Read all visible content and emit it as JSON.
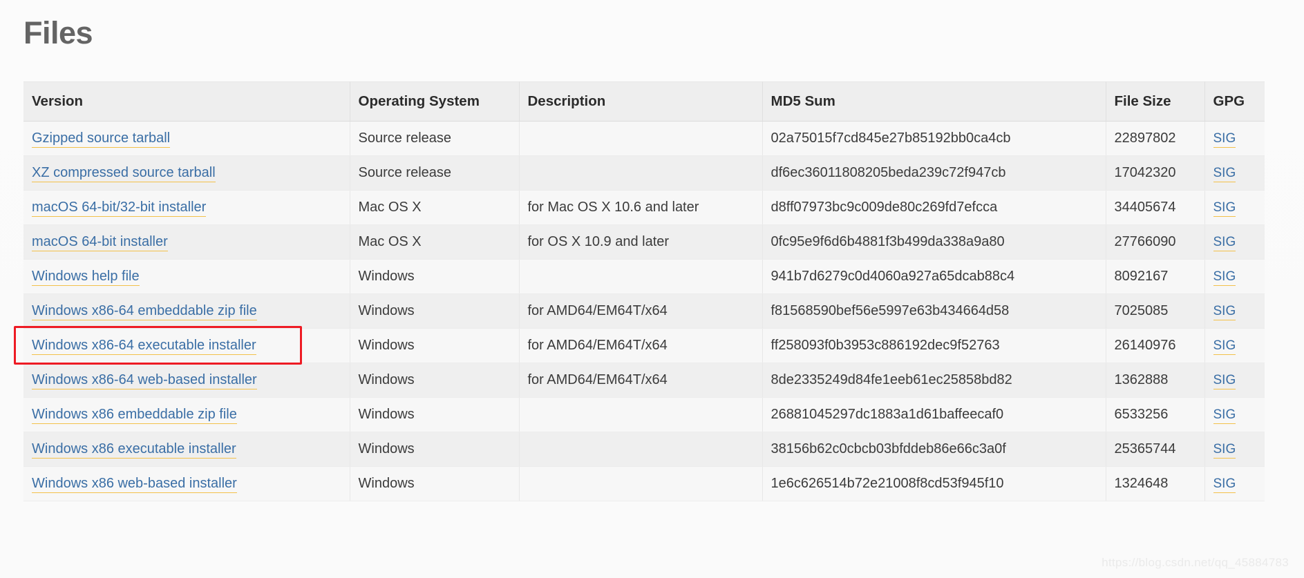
{
  "page": {
    "title": "Files",
    "watermark": "https://blog.csdn.net/qq_45884783"
  },
  "table": {
    "columns": [
      {
        "key": "version",
        "label": "Version"
      },
      {
        "key": "os",
        "label": "Operating System"
      },
      {
        "key": "description",
        "label": "Description"
      },
      {
        "key": "md5",
        "label": "MD5 Sum"
      },
      {
        "key": "filesize",
        "label": "File Size"
      },
      {
        "key": "gpg",
        "label": "GPG"
      }
    ],
    "gpg_link_label": "SIG",
    "rows": [
      {
        "version": "Gzipped source tarball",
        "os": "Source release",
        "description": "",
        "md5": "02a75015f7cd845e27b85192bb0ca4cb",
        "filesize": "22897802",
        "gpg": "SIG"
      },
      {
        "version": "XZ compressed source tarball",
        "os": "Source release",
        "description": "",
        "md5": "df6ec36011808205beda239c72f947cb",
        "filesize": "17042320",
        "gpg": "SIG"
      },
      {
        "version": "macOS 64-bit/32-bit installer",
        "os": "Mac OS X",
        "description": "for Mac OS X 10.6 and later",
        "md5": "d8ff07973bc9c009de80c269fd7efcca",
        "filesize": "34405674",
        "gpg": "SIG"
      },
      {
        "version": "macOS 64-bit installer",
        "os": "Mac OS X",
        "description": "for OS X 10.9 and later",
        "md5": "0fc95e9f6d6b4881f3b499da338a9a80",
        "filesize": "27766090",
        "gpg": "SIG"
      },
      {
        "version": "Windows help file",
        "os": "Windows",
        "description": "",
        "md5": "941b7d6279c0d4060a927a65dcab88c4",
        "filesize": "8092167",
        "gpg": "SIG"
      },
      {
        "version": "Windows x86-64 embeddable zip file",
        "os": "Windows",
        "description": "for AMD64/EM64T/x64",
        "md5": "f81568590bef56e5997e63b434664d58",
        "filesize": "7025085",
        "gpg": "SIG"
      },
      {
        "version": "Windows x86-64 executable installer",
        "os": "Windows",
        "description": "for AMD64/EM64T/x64",
        "md5": "ff258093f0b3953c886192dec9f52763",
        "filesize": "26140976",
        "gpg": "SIG"
      },
      {
        "version": "Windows x86-64 web-based installer",
        "os": "Windows",
        "description": "for AMD64/EM64T/x64",
        "md5": "8de2335249d84fe1eeb61ec25858bd82",
        "filesize": "1362888",
        "gpg": "SIG"
      },
      {
        "version": "Windows x86 embeddable zip file",
        "os": "Windows",
        "description": "",
        "md5": "26881045297dc1883a1d61baffeecaf0",
        "filesize": "6533256",
        "gpg": "SIG"
      },
      {
        "version": "Windows x86 executable installer",
        "os": "Windows",
        "description": "",
        "md5": "38156b62c0cbcb03bfddeb86e66c3a0f",
        "filesize": "25365744",
        "gpg": "SIG"
      },
      {
        "version": "Windows x86 web-based installer",
        "os": "Windows",
        "description": "",
        "md5": "1e6c626514b72e21008f8cd53f945f10",
        "filesize": "1324648",
        "gpg": "SIG"
      }
    ]
  },
  "annotation": {
    "highlight_color": "#ee1b24",
    "highlight_target_row_index": 6,
    "highlight_target_label": "Windows x86-64 executable installer"
  }
}
